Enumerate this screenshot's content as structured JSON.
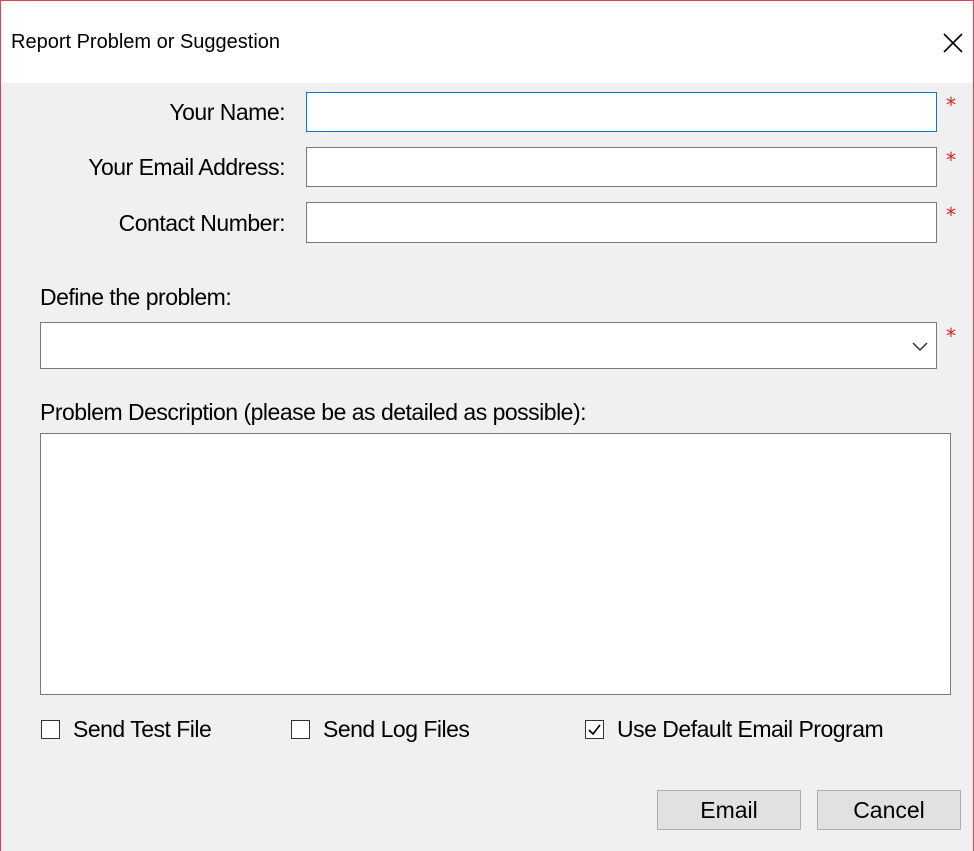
{
  "window": {
    "title": "Report Problem or Suggestion",
    "close_icon": "close-icon"
  },
  "form": {
    "name_label": "Your Name:",
    "name_value": "",
    "email_label": "Your Email Address:",
    "email_value": "",
    "contact_label": "Contact Number:",
    "contact_value": "",
    "required_marker": "*",
    "problem_label": "Define the problem:",
    "problem_value": "",
    "description_label": "Problem Description (please be as detailed as possible):",
    "description_value": ""
  },
  "options": {
    "send_test_file": {
      "label": "Send Test File",
      "checked": false
    },
    "send_log_files": {
      "label": "Send Log Files",
      "checked": false
    },
    "use_default_email": {
      "label": "Use Default Email Program",
      "checked": true
    }
  },
  "buttons": {
    "email_label": "Email",
    "cancel_label": "Cancel"
  },
  "colors": {
    "window_border": "#e0404f",
    "focus_border": "#0078d7",
    "required": "#e02020",
    "dialog_bg": "#f0f0f0"
  }
}
